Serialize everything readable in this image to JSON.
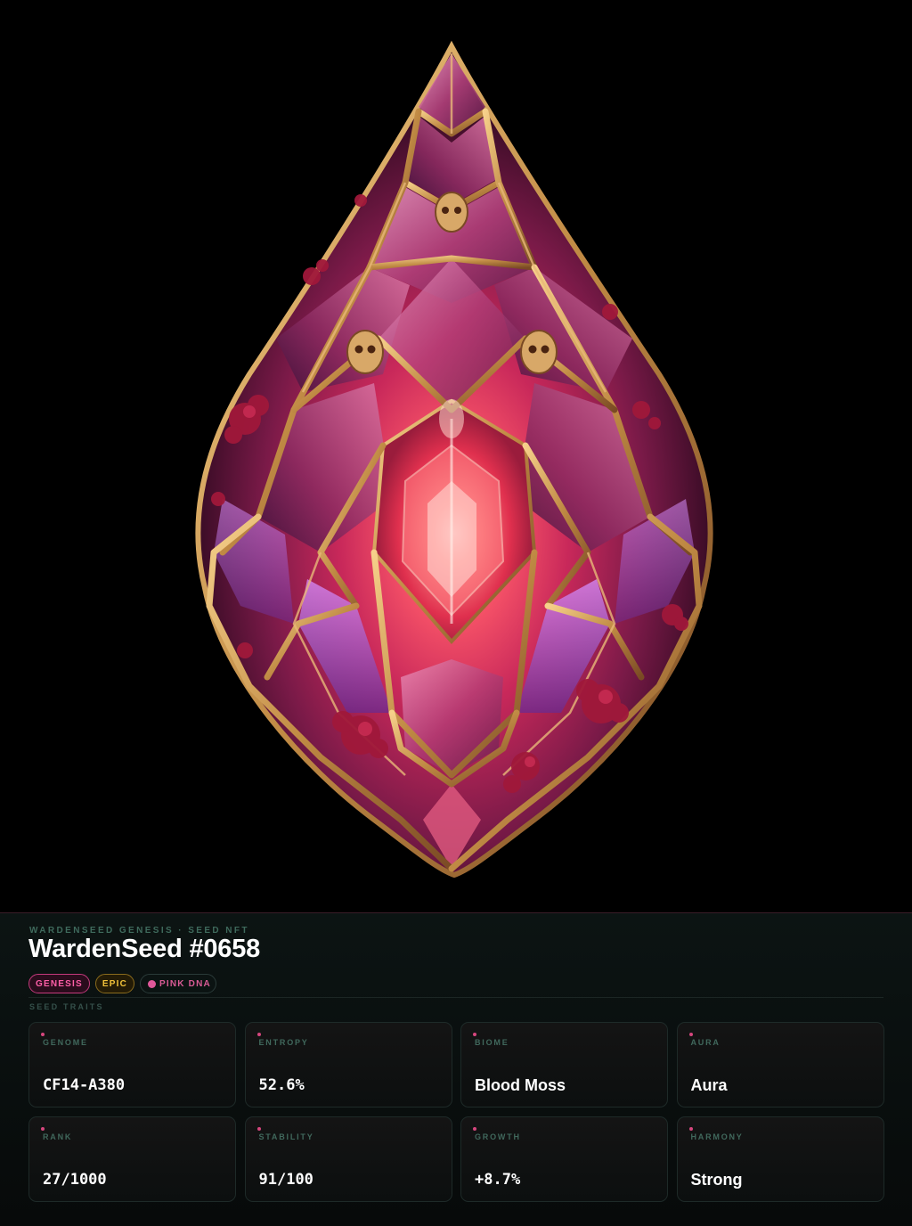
{
  "collection": "WARDENSEED GENESIS · SEED NFT",
  "title": "WardenSeed #0658",
  "badges": {
    "genesis": "GENESIS",
    "epic": "EPIC",
    "dna": "PINK DNA"
  },
  "traits_label": "SEED TRAITS",
  "traits": [
    {
      "label": "GENOME",
      "value": "CF14-A380"
    },
    {
      "label": "ENTROPY",
      "value": "52.6%"
    },
    {
      "label": "BIOME",
      "value": "Blood Moss"
    },
    {
      "label": "AURA",
      "value": "Aura"
    },
    {
      "label": "RANK",
      "value": "27/1000"
    },
    {
      "label": "STABILITY",
      "value": "91/100"
    },
    {
      "label": "GROWTH",
      "value": "+8.7%"
    },
    {
      "label": "HARMONY",
      "value": "Strong"
    }
  ],
  "colors": {
    "background": "#000000",
    "accent_pink": "#e0589a",
    "accent_gold": "#f2c23a",
    "label_green": "#40685c"
  }
}
